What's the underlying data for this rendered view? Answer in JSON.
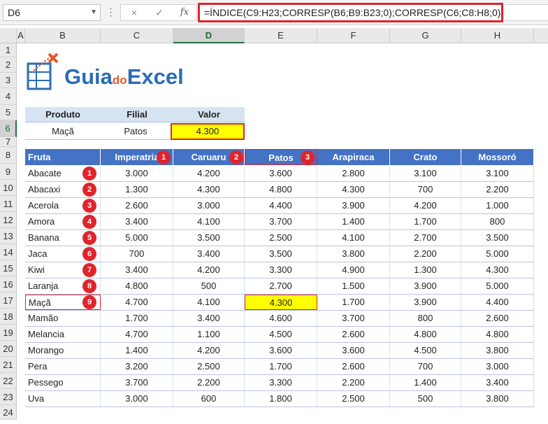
{
  "formula_bar": {
    "name_box": "D6",
    "cancel_icon": "×",
    "enter_icon": "✓",
    "fx_label": "fx",
    "formula": "=ÍNDICE(C9:H23;CORRESP(B6;B9:B23;0);CORRESP(C6;C8:H8;0))"
  },
  "columns": [
    "A",
    "B",
    "C",
    "D",
    "E",
    "F",
    "G",
    "H"
  ],
  "selected_column": "D",
  "rows": [
    "1",
    "2",
    "3",
    "4",
    "5",
    "6",
    "7",
    "8",
    "9",
    "10",
    "11",
    "12",
    "13",
    "14",
    "15",
    "16",
    "17",
    "18",
    "19",
    "20",
    "21",
    "22",
    "23",
    "24"
  ],
  "selected_row": "6",
  "logo": {
    "part1": "Guia",
    "part2": "do",
    "part3": "Excel"
  },
  "lookup": {
    "headers": [
      "Produto",
      "Filial",
      "Valor"
    ],
    "produto": "Maçã",
    "filial": "Patos",
    "valor": "4.300"
  },
  "table": {
    "headers": [
      "Fruta",
      "Imperatriz",
      "Caruaru",
      "Patos",
      "Arapiraca",
      "Crato",
      "Mossoró"
    ],
    "header_badges": [
      "1",
      "2",
      "3"
    ],
    "rows": [
      {
        "fruta": "Abacate",
        "badge": "1",
        "vals": [
          "3.000",
          "4.200",
          "3.600",
          "2.800",
          "3.100",
          "3.100"
        ]
      },
      {
        "fruta": "Abacaxi",
        "badge": "2",
        "vals": [
          "1.300",
          "4.300",
          "4.800",
          "4.300",
          "700",
          "2.200"
        ]
      },
      {
        "fruta": "Acerola",
        "badge": "3",
        "vals": [
          "2.600",
          "3.000",
          "4.400",
          "3.900",
          "4.200",
          "1.000"
        ]
      },
      {
        "fruta": "Amora",
        "badge": "4",
        "vals": [
          "3.400",
          "4.100",
          "3.700",
          "1.400",
          "1.700",
          "800"
        ]
      },
      {
        "fruta": "Banana",
        "badge": "5",
        "vals": [
          "5.000",
          "3.500",
          "2.500",
          "4.100",
          "2.700",
          "3.500"
        ]
      },
      {
        "fruta": "Jaca",
        "badge": "6",
        "vals": [
          "700",
          "3.400",
          "3.500",
          "3.800",
          "2.200",
          "5.000"
        ]
      },
      {
        "fruta": "Kiwi",
        "badge": "7",
        "vals": [
          "3.400",
          "4.200",
          "3.300",
          "4.900",
          "1.300",
          "4.300"
        ]
      },
      {
        "fruta": "Laranja",
        "badge": "8",
        "vals": [
          "4.800",
          "500",
          "2.700",
          "1.500",
          "3.900",
          "5.000"
        ]
      },
      {
        "fruta": "Maçã",
        "badge": "9",
        "vals": [
          "4.700",
          "4.100",
          "4.300",
          "1.700",
          "3.900",
          "4.400"
        ]
      },
      {
        "fruta": "Mamão",
        "badge": "",
        "vals": [
          "1.700",
          "3.400",
          "4.600",
          "3.700",
          "800",
          "2.600"
        ]
      },
      {
        "fruta": "Melancia",
        "badge": "",
        "vals": [
          "4.700",
          "1.100",
          "4.500",
          "2.600",
          "4.800",
          "4.800"
        ]
      },
      {
        "fruta": "Morango",
        "badge": "",
        "vals": [
          "1.400",
          "4.200",
          "3.600",
          "3.600",
          "4.500",
          "3.800"
        ]
      },
      {
        "fruta": "Pera",
        "badge": "",
        "vals": [
          "3.200",
          "2.500",
          "1.700",
          "2.600",
          "700",
          "3.000"
        ]
      },
      {
        "fruta": "Pessego",
        "badge": "",
        "vals": [
          "3.700",
          "2.200",
          "3.300",
          "2.200",
          "1.400",
          "3.400"
        ]
      },
      {
        "fruta": "Uva",
        "badge": "",
        "vals": [
          "3.000",
          "600",
          "1.800",
          "2.500",
          "500",
          "3.800"
        ]
      }
    ]
  },
  "colors": {
    "accent_red": "#e0242c",
    "header_blue": "#4472c4",
    "highlight_yellow": "#ffff00",
    "logo_blue": "#2b6cb5"
  }
}
